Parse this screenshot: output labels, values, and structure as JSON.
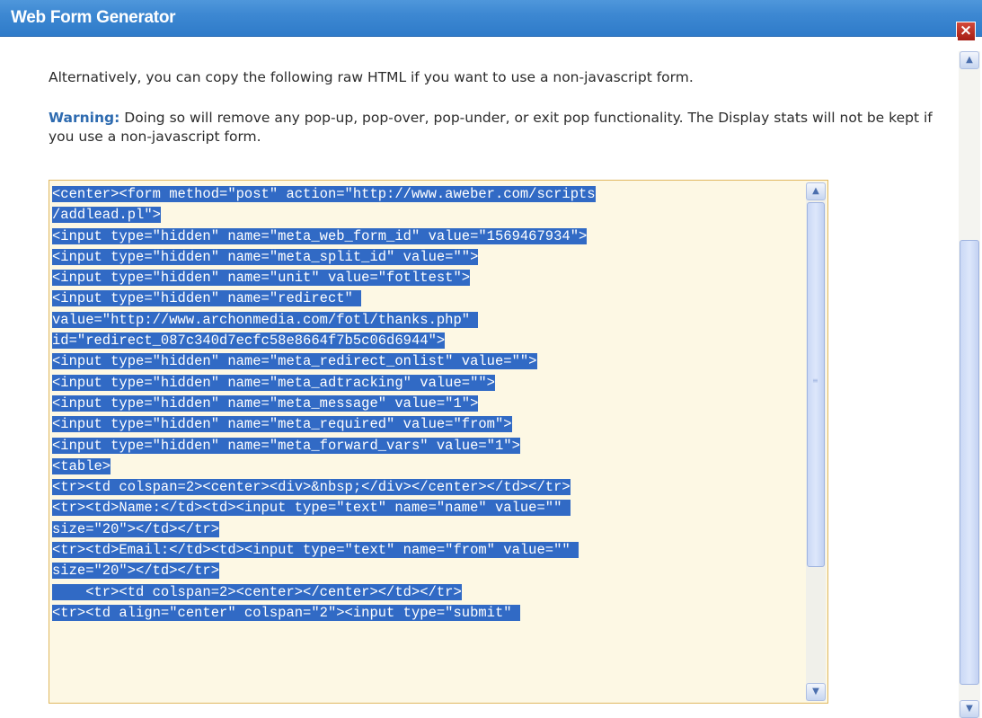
{
  "window": {
    "title": "Web Form Generator",
    "close_glyph": "×"
  },
  "content": {
    "intro": "Alternatively, you can copy the following raw HTML if you want to use a non-javascript form.",
    "warning_label": "Warning:",
    "warning_text": " Doing so will remove any pop-up, pop-over, pop-under, or exit pop functionality. The Display stats will not be kept if you use a non-javascript form."
  },
  "code_lines": [
    "<center><form method=\"post\" action=\"http://www.aweber.com/scripts",
    "/addlead.pl\">",
    "<input type=\"hidden\" name=\"meta_web_form_id\" value=\"1569467934\">",
    "<input type=\"hidden\" name=\"meta_split_id\" value=\"\">",
    "<input type=\"hidden\" name=\"unit\" value=\"fotltest\">",
    "<input type=\"hidden\" name=\"redirect\" ",
    "value=\"http://www.archonmedia.com/fotl/thanks.php\" ",
    "id=\"redirect_087c340d7ecfc58e8664f7b5c06d6944\">",
    "<input type=\"hidden\" name=\"meta_redirect_onlist\" value=\"\">",
    "<input type=\"hidden\" name=\"meta_adtracking\" value=\"\">",
    "<input type=\"hidden\" name=\"meta_message\" value=\"1\">",
    "<input type=\"hidden\" name=\"meta_required\" value=\"from\">",
    "<input type=\"hidden\" name=\"meta_forward_vars\" value=\"1\">",
    "<table>",
    "<tr><td colspan=2><center><div>&nbsp;</div></center></td></tr>",
    "<tr><td>Name:</td><td><input type=\"text\" name=\"name\" value=\"\" ",
    "size=\"20\"></td></tr>",
    "<tr><td>Email:</td><td><input type=\"text\" name=\"from\" value=\"\" ",
    "size=\"20\"></td></tr>",
    "    <tr><td colspan=2><center></center></td></tr>",
    "<tr><td align=\"center\" colspan=\"2\"><input type=\"submit\" "
  ],
  "icons": {
    "close": "close-icon",
    "scroll_up": "chevron-up-icon",
    "scroll_down": "chevron-down-icon"
  },
  "colors": {
    "titlebar": "#3d88d2",
    "selection": "#316ac5",
    "code_background": "#fdf8e4",
    "warning": "#2e6bb0",
    "close_button": "#c23b2e"
  }
}
